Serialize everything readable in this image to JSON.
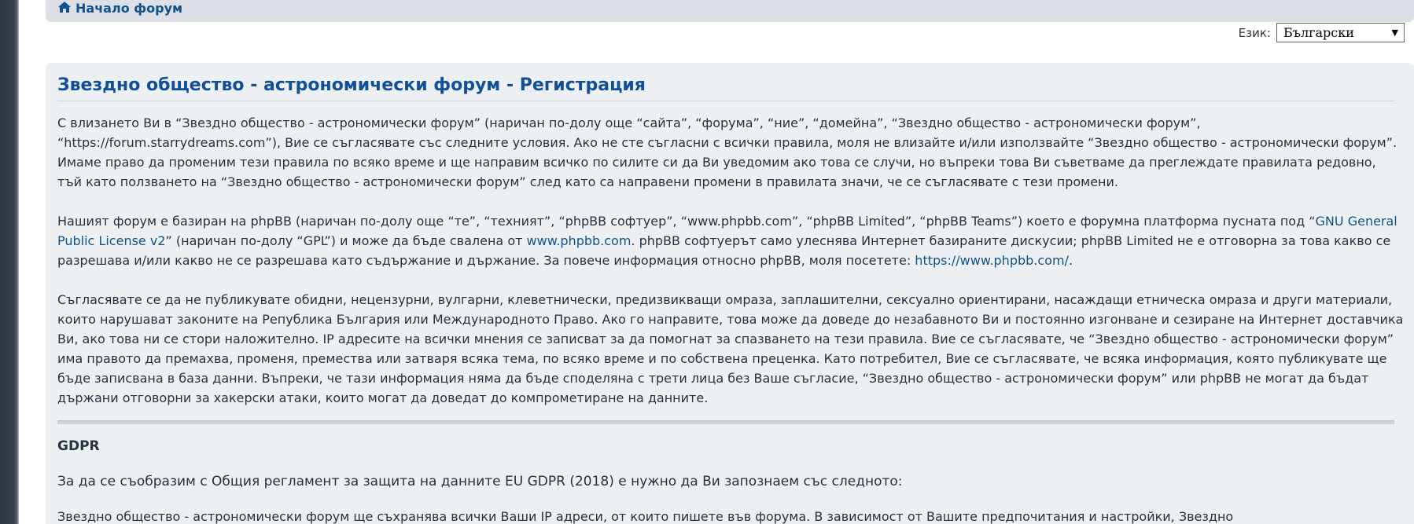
{
  "nav": {
    "home_label": "Начало форум"
  },
  "language": {
    "label": "Език:",
    "selected": "Български"
  },
  "panel": {
    "title": "Звездно общество - астрономически форум - Регистрация",
    "para1": "С влизането Ви в “Звездно общество - астрономически форум” (наричан по-долу още “сайта”, “форума”, “ние”, “домейна”, “Звездно общество - астрономически форум”, “https://forum.starrydreams.com”), Вие се съгласявате със следните условия. Ако не сте съгласни с всички правила, моля не влизайте и/или използвайте “Звездно общество - астрономически форум”. Имаме право да променим тези правила по всяко време и ще направим всичко по силите си да Ви уведомим ако това се случи, но въпреки това Ви съветваме да преглеждате правилата редовно, тъй като ползването на “Звездно общество - астрономически форум” след като са направени промени в правилата значи, че се съгласявате с тези промени.",
    "para2": {
      "text_a": "Нашият форум е базиран на phpBB (наричан по-долу още “те”, “техният”, “phpBB софтуер”, “www.phpbb.com”, “phpBB Limited”, “phpBB Teams”) което е форумна платформа пусната под “",
      "link_gpl": "GNU General Public License v2",
      "text_b": "” (наричан по-долу “GPL”) и може да бъде свалена от ",
      "link_phpbb": "www.phpbb.com",
      "text_c": ". phpBB софтуерът само улеснява Интернет базираните дискусии; phpBB Limited не е отговорна за това какво се разрешава и/или какво не се разрешава като съдържание и държание. За повече информация относно phpBB, моля посетете: ",
      "link_phpbb_full": "https://www.phpbb.com/",
      "text_d": "."
    },
    "para3": "Съгласявате се да не публикувате обидни, нецензурни, вулгарни, клеветнически, предизвикващи омраза, заплашителни, сексуално ориентирани, насаждащи етническа омраза и други материали, които нарушават законите на Република България или Международното Право. Ако го направите, това може да доведе до незабавното Ви и постоянно изгонване и сезиране на Интернет доставчика Ви, ако това ни се стори наложително. IP адресите на всички мнения се записват за да помогнат за спазването на тези правила. Вие се съгласявате, че “Звездно общество - астрономически форум” има правото да премахва, променя, премества или затваря всяка тема, по всяко време и по собствена преценка. Като потребител, Вие се съгласявате, че всяка информация, която публикувате ще бъде записвана в база данни. Въпреки, че тази информация няма да бъде споделяна с трети лица без Ваше съгласие, “Звездно общество - астрономически форум” или phpBB не могат да бъдат държани отговорни за хакерски атаки, които могат да доведат до компрометиране на данните.",
    "gdpr_title": "GDPR",
    "gdpr_intro": "За да се съобразим с Общия регламент за защита на данните EU GDPR (2018) е нужно да Ви запознаем със следното:",
    "gdpr_para_start": "Звездно общество - астрономически форум ще съхранява всички Ваши IP адреси, от които пишете във форума. В зависимост от Вашите предпочитания и настройки, Звездно"
  }
}
